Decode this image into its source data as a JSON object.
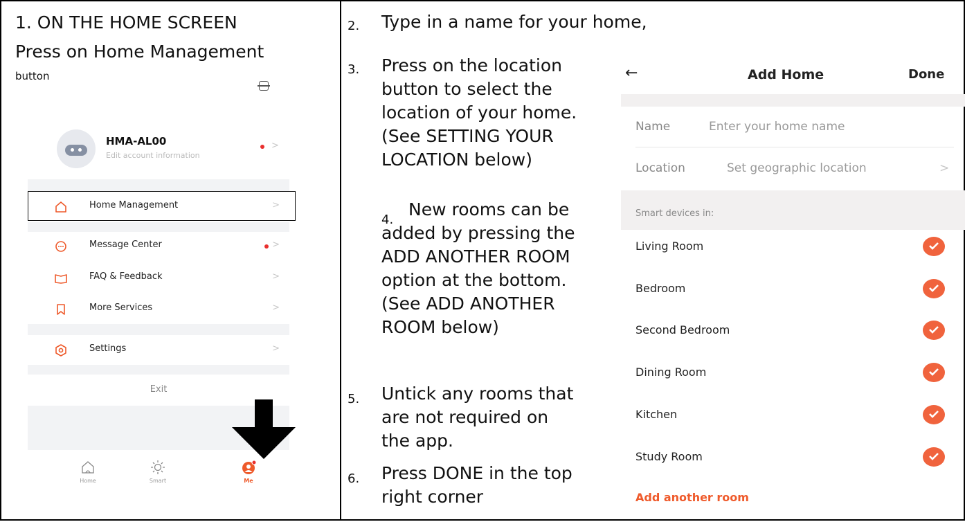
{
  "left": {
    "heading1": "1. ON THE HOME SCREEN",
    "heading2": "Press on Home Management",
    "heading3": "button",
    "account": {
      "name": "HMA-AL00",
      "subtitle": "Edit account information"
    },
    "menu": [
      {
        "label": "Home Management",
        "icon": "home-icon"
      },
      {
        "label": "Message Center",
        "icon": "chat-bubble-icon"
      },
      {
        "label": "FAQ & Feedback",
        "icon": "book-icon"
      },
      {
        "label": "More Services",
        "icon": "bookmark-icon"
      },
      {
        "label": "Settings",
        "icon": "hexagon-gear-icon"
      }
    ],
    "exit": "Exit",
    "tabs": [
      {
        "label": "Home",
        "icon": "house-icon"
      },
      {
        "label": "Smart",
        "icon": "sun-icon"
      },
      {
        "label": "Me",
        "icon": "user-icon"
      }
    ],
    "accent_color": "#ee5a2b"
  },
  "right": {
    "steps": {
      "n2": "2.",
      "s2": "Type in a name for your home,",
      "n3": "3.",
      "s3": [
        "Press on the location",
        "button to select the",
        "location of your home.",
        "(See SETTING YOUR",
        "LOCATION below)"
      ],
      "n4": "4.",
      "s4": [
        "New rooms can be",
        "added by pressing the",
        "ADD ANOTHER ROOM",
        "option at the bottom.",
        "(See ADD ANOTHER",
        "ROOM below)"
      ],
      "n5": "5.",
      "s5": [
        "Untick any rooms that",
        "are not required on",
        "the app."
      ],
      "n6": "6.",
      "s6": [
        "Press DONE in the top",
        "right corner"
      ]
    },
    "add_home": {
      "back": "←",
      "title": "Add Home",
      "done": "Done",
      "name_label": "Name",
      "name_placeholder": "Enter your home name",
      "location_label": "Location",
      "location_value": "Set geographic location",
      "chevron": ">",
      "section": "Smart devices in:",
      "rooms": [
        "Living Room",
        "Bedroom",
        "Second Bedroom",
        "Dining Room",
        "Kitchen",
        "Study Room"
      ],
      "add_room": "Add another room",
      "check_color": "#f0633d"
    }
  }
}
